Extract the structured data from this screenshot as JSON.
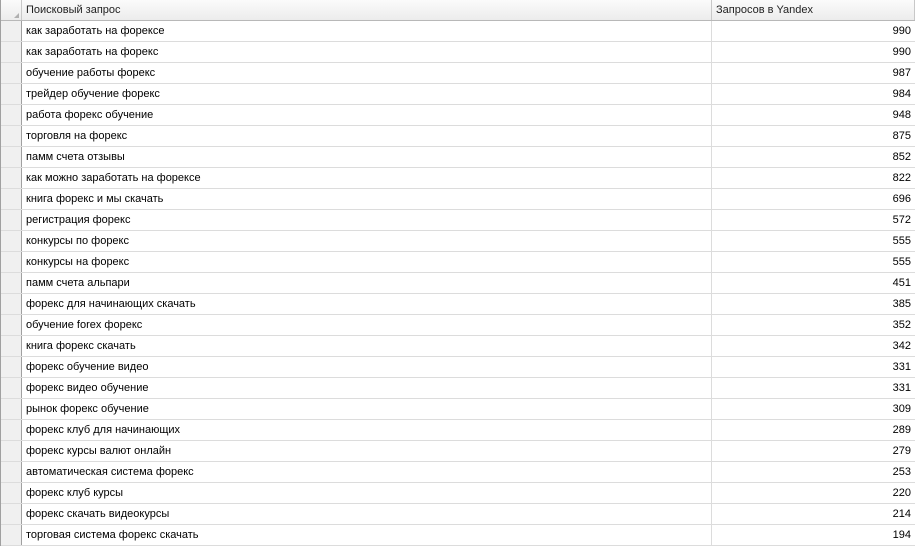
{
  "columns": {
    "query": "Поисковый запрос",
    "count": "Запросов в Yandex"
  },
  "rows": [
    {
      "query": "как заработать на форексе",
      "count": "990"
    },
    {
      "query": "как заработать на форекс",
      "count": "990"
    },
    {
      "query": "обучение работы форекс",
      "count": "987"
    },
    {
      "query": "трейдер обучение форекс",
      "count": "984"
    },
    {
      "query": "работа форекс обучение",
      "count": "948"
    },
    {
      "query": "торговля на форекс",
      "count": "875"
    },
    {
      "query": "памм счета отзывы",
      "count": "852"
    },
    {
      "query": "как можно заработать на форексе",
      "count": "822"
    },
    {
      "query": "книга форекс и мы скачать",
      "count": "696"
    },
    {
      "query": "регистрация форекс",
      "count": "572"
    },
    {
      "query": "конкурсы по форекс",
      "count": "555"
    },
    {
      "query": "конкурсы на форекс",
      "count": "555"
    },
    {
      "query": "памм счета альпари",
      "count": "451"
    },
    {
      "query": "форекс для начинающих скачать",
      "count": "385"
    },
    {
      "query": "обучение forex форекс",
      "count": "352"
    },
    {
      "query": "книга форекс скачать",
      "count": "342"
    },
    {
      "query": "форекс обучение видео",
      "count": "331"
    },
    {
      "query": "форекс видео обучение",
      "count": "331"
    },
    {
      "query": "рынок форекс обучение",
      "count": "309"
    },
    {
      "query": "форекс клуб для начинающих",
      "count": "289"
    },
    {
      "query": "форекс курсы валют онлайн",
      "count": "279"
    },
    {
      "query": "автоматическая система форекс",
      "count": "253"
    },
    {
      "query": "форекс клуб курсы",
      "count": "220"
    },
    {
      "query": "форекс скачать видеокурсы",
      "count": "214"
    },
    {
      "query": "торговая система форекс скачать",
      "count": "194"
    }
  ]
}
